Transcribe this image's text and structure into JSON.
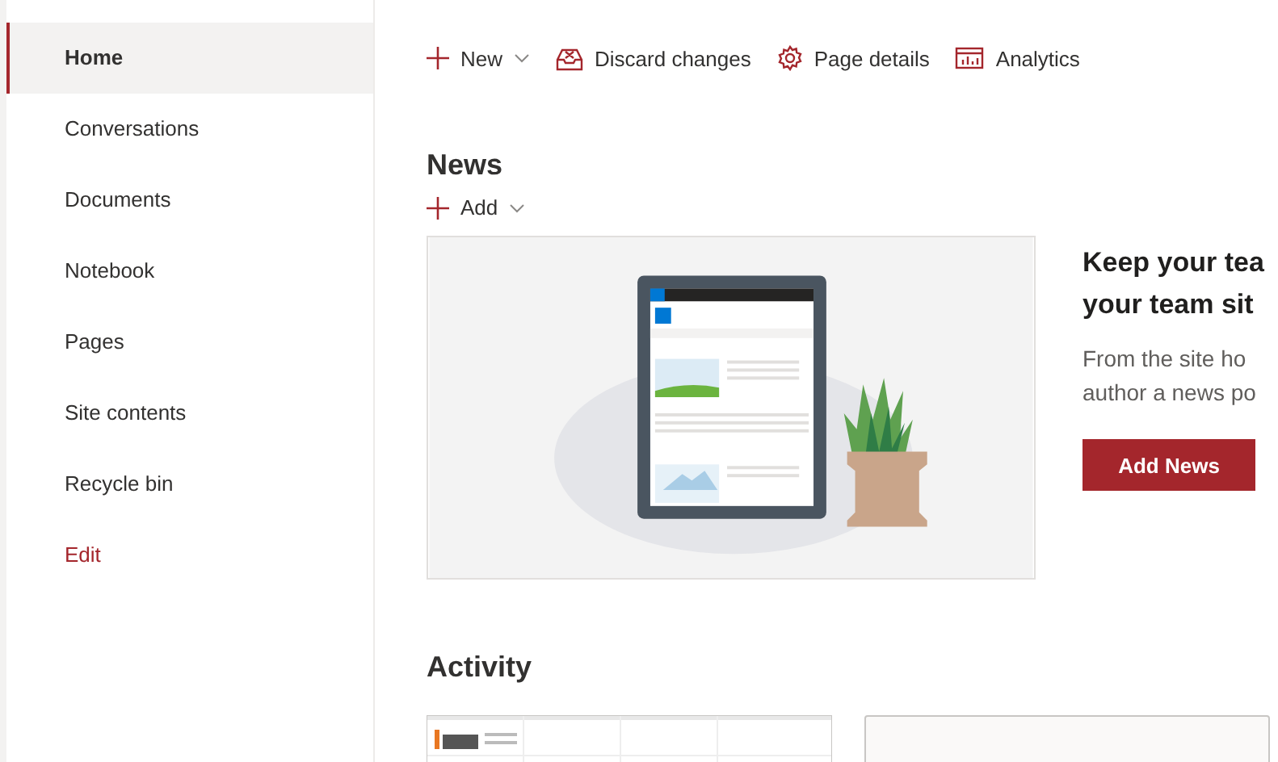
{
  "sidebar": {
    "items": [
      {
        "label": "Home",
        "selected": true,
        "kind": "link"
      },
      {
        "label": "Conversations",
        "selected": false,
        "kind": "link"
      },
      {
        "label": "Documents",
        "selected": false,
        "kind": "link"
      },
      {
        "label": "Notebook",
        "selected": false,
        "kind": "link"
      },
      {
        "label": "Pages",
        "selected": false,
        "kind": "link"
      },
      {
        "label": "Site contents",
        "selected": false,
        "kind": "link"
      },
      {
        "label": "Recycle bin",
        "selected": false,
        "kind": "link"
      },
      {
        "label": "Edit",
        "selected": false,
        "kind": "edit"
      }
    ]
  },
  "command_bar": [
    {
      "label": "New",
      "kind": "new"
    },
    {
      "label": "Discard changes",
      "kind": "discard"
    },
    {
      "label": "Page details",
      "kind": "details"
    },
    {
      "label": "Analytics",
      "kind": "analytics"
    }
  ],
  "news": {
    "title": "News",
    "add_label": "Add",
    "promo": {
      "headline": [
        "Keep your tea",
        "your team sit"
      ],
      "body": [
        "From the site ho",
        "author a news po"
      ],
      "button": "Add News"
    }
  },
  "activity": {
    "title": "Activity",
    "cards": [
      {
        "kind": "picture"
      },
      {
        "kind": "empty"
      }
    ]
  }
}
